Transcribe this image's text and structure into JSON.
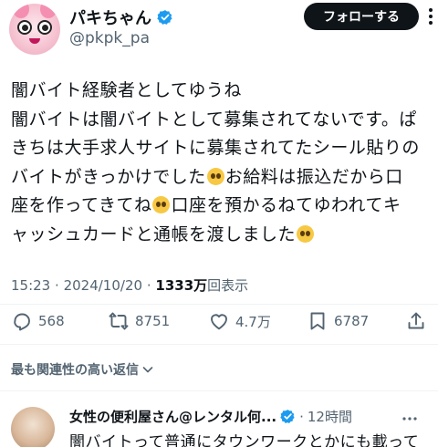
{
  "author": {
    "display_name": "パキちゃん",
    "handle": "@pkpk_pa",
    "verified_icon": "verified-badge-icon"
  },
  "follow_button": "フォローする",
  "tweet": {
    "lines": [
      [
        "闇バイト経験者としてゆうね"
      ],
      [
        "闇バイトは闇バイトとして募集されてないです。ぱ"
      ],
      [
        "きちは大手求人サイトに募集されてたシール貼りの"
      ],
      [
        "バイトがきっかけでした",
        "お給料は振込だから口"
      ],
      [
        "座を作ってきてね",
        "口座を預かるねてゆわれてキ"
      ],
      [
        "ャッシュカードと通帳を渡しました",
        ""
      ]
    ],
    "emoji": "pleading-face-emoji"
  },
  "meta": {
    "time": "15:23",
    "separator": "·",
    "date": "2024/10/20",
    "views_count": "1333万",
    "views_label": "回表示"
  },
  "actions": {
    "replies": "568",
    "reposts": "8751",
    "likes": "4.7万",
    "bookmarks": "6787"
  },
  "sort_label": "最も関連性の高い返信",
  "reply": {
    "name": "女性の便利屋さん@レンタル何...",
    "separator": "·",
    "time": "12時間",
    "text": "闇バイトって普通にタウンワークとかにも載って"
  },
  "colors": {
    "text": "#0f1419",
    "secondary": "#536471",
    "verified": "#1d9bf0",
    "follow_bg": "#0f1419"
  }
}
